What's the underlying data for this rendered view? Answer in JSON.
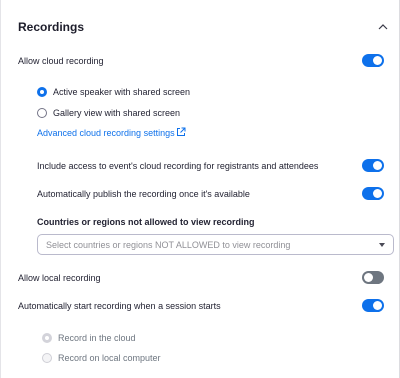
{
  "section": {
    "title": "Recordings",
    "collapse_icon": "chevron-up-icon"
  },
  "cloud_recording": {
    "label": "Allow cloud recording",
    "enabled": true,
    "options": [
      {
        "label": "Active speaker with shared screen",
        "selected": true
      },
      {
        "label": "Gallery view with shared screen",
        "selected": false
      }
    ],
    "advanced_link": "Advanced cloud recording settings",
    "advanced_link_icon": "external-link-icon"
  },
  "settings": [
    {
      "label": "Include access to event's cloud recording for registrants and attendees",
      "enabled": true
    },
    {
      "label": "Automatically publish the recording once it's available",
      "enabled": true
    }
  ],
  "restricted_regions": {
    "heading": "Countries or regions not allowed to view recording",
    "placeholder": "Select countries or regions NOT ALLOWED to view recording"
  },
  "local_recording": {
    "label": "Allow local recording",
    "enabled": false
  },
  "auto_start": {
    "label": "Automatically start recording when a session starts",
    "enabled": true,
    "options": [
      {
        "label": "Record in the cloud",
        "selected": true,
        "disabled": true
      },
      {
        "label": "Record on local computer",
        "selected": false,
        "disabled": true
      }
    ]
  },
  "colors": {
    "accent": "#0e71eb",
    "toggle_off": "#6e7680"
  }
}
